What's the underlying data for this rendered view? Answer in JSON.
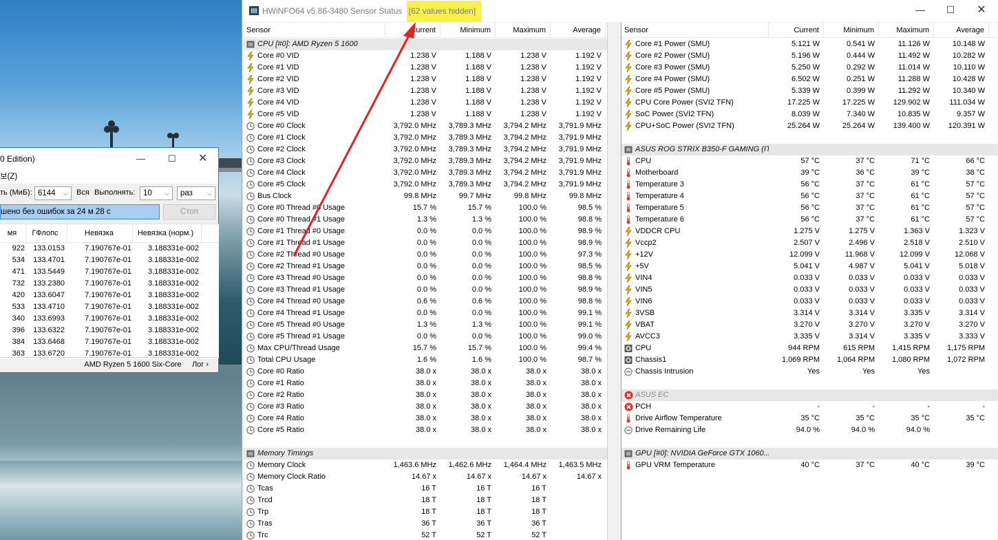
{
  "hwinfo": {
    "title": "HWiNFO64 v5.86-3480 Sensor Status",
    "title_highlight": "[62 values hidden]",
    "columns": [
      "Sensor",
      "Current",
      "Minimum",
      "Maximum",
      "Average"
    ],
    "left": [
      {
        "g": "CPU [#0]: AMD Ryzen 5 1600"
      },
      {
        "i": "bolt",
        "n": "Core #0 VID",
        "v": [
          "1.238 V",
          "1.188 V",
          "1.238 V",
          "1.192 V"
        ]
      },
      {
        "i": "bolt",
        "n": "Core #1 VID",
        "v": [
          "1.238 V",
          "1.188 V",
          "1.238 V",
          "1.192 V"
        ]
      },
      {
        "i": "bolt",
        "n": "Core #2 VID",
        "v": [
          "1.238 V",
          "1.188 V",
          "1.238 V",
          "1.192 V"
        ]
      },
      {
        "i": "bolt",
        "n": "Core #3 VID",
        "v": [
          "1.238 V",
          "1.188 V",
          "1.238 V",
          "1.192 V"
        ]
      },
      {
        "i": "bolt",
        "n": "Core #4 VID",
        "v": [
          "1.238 V",
          "1.188 V",
          "1.238 V",
          "1.192 V"
        ]
      },
      {
        "i": "bolt",
        "n": "Core #5 VID",
        "v": [
          "1.238 V",
          "1.188 V",
          "1.238 V",
          "1.192 V"
        ]
      },
      {
        "i": "clock",
        "n": "Core #0 Clock",
        "v": [
          "3,792.0 MHz",
          "3,789.3 MHz",
          "3,794.2 MHz",
          "3,791.9 MHz"
        ]
      },
      {
        "i": "clock",
        "n": "Core #1 Clock",
        "v": [
          "3,792.0 MHz",
          "3,789.3 MHz",
          "3,794.2 MHz",
          "3,791.9 MHz"
        ]
      },
      {
        "i": "clock",
        "n": "Core #2 Clock",
        "v": [
          "3,792.0 MHz",
          "3,789.3 MHz",
          "3,794.2 MHz",
          "3,791.9 MHz"
        ]
      },
      {
        "i": "clock",
        "n": "Core #3 Clock",
        "v": [
          "3,792.0 MHz",
          "3,789.3 MHz",
          "3,794.2 MHz",
          "3,791.9 MHz"
        ]
      },
      {
        "i": "clock",
        "n": "Core #4 Clock",
        "v": [
          "3,792.0 MHz",
          "3,789.3 MHz",
          "3,794.2 MHz",
          "3,791.9 MHz"
        ]
      },
      {
        "i": "clock",
        "n": "Core #5 Clock",
        "v": [
          "3,792.0 MHz",
          "3,789.3 MHz",
          "3,794.2 MHz",
          "3,791.9 MHz"
        ]
      },
      {
        "i": "clock",
        "n": "Bus Clock",
        "v": [
          "99.8 MHz",
          "99.7 MHz",
          "99.8 MHz",
          "99.8 MHz"
        ]
      },
      {
        "i": "clock",
        "n": "Core #0 Thread #0 Usage",
        "v": [
          "15.7 %",
          "15.7 %",
          "100.0 %",
          "98.5 %"
        ]
      },
      {
        "i": "clock",
        "n": "Core #0 Thread #1 Usage",
        "v": [
          "1.3 %",
          "1.3 %",
          "100.0 %",
          "98.8 %"
        ]
      },
      {
        "i": "clock",
        "n": "Core #1 Thread #0 Usage",
        "v": [
          "0.0 %",
          "0.0 %",
          "100.0 %",
          "98.9 %"
        ]
      },
      {
        "i": "clock",
        "n": "Core #1 Thread #1 Usage",
        "v": [
          "0.0 %",
          "0.0 %",
          "100.0 %",
          "98.9 %"
        ]
      },
      {
        "i": "clock",
        "n": "Core #2 Thread #0 Usage",
        "v": [
          "0.0 %",
          "0.0 %",
          "100.0 %",
          "97.3 %"
        ]
      },
      {
        "i": "clock",
        "n": "Core #2 Thread #1 Usage",
        "v": [
          "0.0 %",
          "0.0 %",
          "100.0 %",
          "98.5 %"
        ]
      },
      {
        "i": "clock",
        "n": "Core #3 Thread #0 Usage",
        "v": [
          "0.0 %",
          "0.0 %",
          "100.0 %",
          "98.8 %"
        ]
      },
      {
        "i": "clock",
        "n": "Core #3 Thread #1 Usage",
        "v": [
          "0.0 %",
          "0.0 %",
          "100.0 %",
          "98.9 %"
        ]
      },
      {
        "i": "clock",
        "n": "Core #4 Thread #0 Usage",
        "v": [
          "0.6 %",
          "0.6 %",
          "100.0 %",
          "98.8 %"
        ]
      },
      {
        "i": "clock",
        "n": "Core #4 Thread #1 Usage",
        "v": [
          "0.0 %",
          "0.0 %",
          "100.0 %",
          "99.1 %"
        ]
      },
      {
        "i": "clock",
        "n": "Core #5 Thread #0 Usage",
        "v": [
          "1.3 %",
          "1.3 %",
          "100.0 %",
          "99.1 %"
        ]
      },
      {
        "i": "clock",
        "n": "Core #5 Thread #1 Usage",
        "v": [
          "0.0 %",
          "0.0 %",
          "100.0 %",
          "99.0 %"
        ]
      },
      {
        "i": "clock",
        "n": "Max CPU/Thread Usage",
        "v": [
          "15.7 %",
          "15.7 %",
          "100.0 %",
          "99.4 %"
        ]
      },
      {
        "i": "clock",
        "n": "Total CPU Usage",
        "v": [
          "1.6 %",
          "1.6 %",
          "100.0 %",
          "98.7 %"
        ]
      },
      {
        "i": "clock",
        "n": "Core #0 Ratio",
        "v": [
          "38.0 x",
          "38.0 x",
          "38.0 x",
          "38.0 x"
        ]
      },
      {
        "i": "clock",
        "n": "Core #1 Ratio",
        "v": [
          "38.0 x",
          "38.0 x",
          "38.0 x",
          "38.0 x"
        ]
      },
      {
        "i": "clock",
        "n": "Core #2 Ratio",
        "v": [
          "38.0 x",
          "38.0 x",
          "38.0 x",
          "38.0 x"
        ]
      },
      {
        "i": "clock",
        "n": "Core #3 Ratio",
        "v": [
          "38.0 x",
          "38.0 x",
          "38.0 x",
          "38.0 x"
        ]
      },
      {
        "i": "clock",
        "n": "Core #4 Ratio",
        "v": [
          "38.0 x",
          "38.0 x",
          "38.0 x",
          "38.0 x"
        ]
      },
      {
        "i": "clock",
        "n": "Core #5 Ratio",
        "v": [
          "38.0 x",
          "38.0 x",
          "38.0 x",
          "38.0 x"
        ]
      },
      {
        "blank": true
      },
      {
        "g": "Memory Timings"
      },
      {
        "i": "clock",
        "n": "Memory Clock",
        "v": [
          "1,463.6 MHz",
          "1,462.6 MHz",
          "1,464.4 MHz",
          "1,463.5 MHz"
        ]
      },
      {
        "i": "clock",
        "n": "Memory Clock Ratio",
        "v": [
          "14.67 x",
          "14.67 x",
          "14.67 x",
          "14.67 x"
        ]
      },
      {
        "i": "clock",
        "n": "Tcas",
        "v": [
          "16 T",
          "16 T",
          "16 T",
          ""
        ]
      },
      {
        "i": "clock",
        "n": "Trcd",
        "v": [
          "18 T",
          "18 T",
          "18 T",
          ""
        ]
      },
      {
        "i": "clock",
        "n": "Trp",
        "v": [
          "18 T",
          "18 T",
          "18 T",
          ""
        ]
      },
      {
        "i": "clock",
        "n": "Tras",
        "v": [
          "36 T",
          "36 T",
          "36 T",
          ""
        ]
      },
      {
        "i": "clock",
        "n": "Trc",
        "v": [
          "52 T",
          "52 T",
          "52 T",
          ""
        ]
      }
    ],
    "right": [
      {
        "i": "bolt",
        "n": "Core #1 Power (SMU)",
        "v": [
          "5.121 W",
          "0.541 W",
          "11.126 W",
          "10.148 W"
        ]
      },
      {
        "i": "bolt",
        "n": "Core #2 Power (SMU)",
        "v": [
          "5.196 W",
          "0.444 W",
          "11.492 W",
          "10.282 W"
        ]
      },
      {
        "i": "bolt",
        "n": "Core #3 Power (SMU)",
        "v": [
          "5.250 W",
          "0.292 W",
          "11.014 W",
          "10.110 W"
        ]
      },
      {
        "i": "bolt",
        "n": "Core #4 Power (SMU)",
        "v": [
          "6.502 W",
          "0.251 W",
          "11.288 W",
          "10.428 W"
        ]
      },
      {
        "i": "bolt",
        "n": "Core #5 Power (SMU)",
        "v": [
          "5.339 W",
          "0.399 W",
          "11.292 W",
          "10.340 W"
        ]
      },
      {
        "i": "bolt",
        "n": "CPU Core Power (SVI2 TFN)",
        "v": [
          "17.225 W",
          "17.225 W",
          "129.902 W",
          "111.034 W"
        ]
      },
      {
        "i": "bolt",
        "n": "SoC Power (SVI2 TFN)",
        "v": [
          "8.039 W",
          "7.340 W",
          "10.835 W",
          "9.357 W"
        ]
      },
      {
        "i": "bolt",
        "n": "CPU+SoC Power (SVI2 TFN)",
        "v": [
          "25.264 W",
          "25.264 W",
          "139.400 W",
          "120.391 W"
        ]
      },
      {
        "blank": true
      },
      {
        "g": "ASUS ROG STRIX B350-F GAMING (IT..."
      },
      {
        "i": "therm",
        "n": "CPU",
        "v": [
          "57 °C",
          "37 °C",
          "71 °C",
          "66 °C"
        ]
      },
      {
        "i": "therm",
        "n": "Motherboard",
        "v": [
          "39 °C",
          "36 °C",
          "39 °C",
          "38 °C"
        ]
      },
      {
        "i": "therm",
        "n": "Temperature 3",
        "v": [
          "56 °C",
          "37 °C",
          "61 °C",
          "57 °C"
        ]
      },
      {
        "i": "therm",
        "n": "Temperature 4",
        "v": [
          "56 °C",
          "37 °C",
          "61 °C",
          "57 °C"
        ]
      },
      {
        "i": "therm",
        "n": "Temperature 5",
        "v": [
          "56 °C",
          "37 °C",
          "61 °C",
          "57 °C"
        ]
      },
      {
        "i": "therm",
        "n": "Temperature 6",
        "v": [
          "56 °C",
          "37 °C",
          "61 °C",
          "57 °C"
        ]
      },
      {
        "i": "bolt",
        "n": "VDDCR CPU",
        "v": [
          "1.275 V",
          "1.275 V",
          "1.363 V",
          "1.323 V"
        ]
      },
      {
        "i": "bolt",
        "n": "Vccp2",
        "v": [
          "2.507 V",
          "2.496 V",
          "2.518 V",
          "2.510 V"
        ]
      },
      {
        "i": "bolt",
        "n": "+12V",
        "v": [
          "12.099 V",
          "11.968 V",
          "12.099 V",
          "12.068 V"
        ]
      },
      {
        "i": "bolt",
        "n": "+5V",
        "v": [
          "5.041 V",
          "4.987 V",
          "5.041 V",
          "5.018 V"
        ]
      },
      {
        "i": "bolt",
        "n": "VIN4",
        "v": [
          "0.033 V",
          "0.033 V",
          "0.033 V",
          "0.033 V"
        ]
      },
      {
        "i": "bolt",
        "n": "VIN5",
        "v": [
          "0.033 V",
          "0.033 V",
          "0.033 V",
          "0.033 V"
        ]
      },
      {
        "i": "bolt",
        "n": "VIN6",
        "v": [
          "0.033 V",
          "0.033 V",
          "0.033 V",
          "0.033 V"
        ]
      },
      {
        "i": "bolt",
        "n": "3VSB",
        "v": [
          "3.314 V",
          "3.314 V",
          "3.335 V",
          "3.314 V"
        ]
      },
      {
        "i": "bolt",
        "n": "VBAT",
        "v": [
          "3.270 V",
          "3.270 V",
          "3.270 V",
          "3.270 V"
        ]
      },
      {
        "i": "bolt",
        "n": "AVCC3",
        "v": [
          "3.335 V",
          "3.314 V",
          "3.335 V",
          "3.333 V"
        ]
      },
      {
        "i": "fan",
        "n": "CPU",
        "v": [
          "944 RPM",
          "615 RPM",
          "1,415 RPM",
          "1,175 RPM"
        ]
      },
      {
        "i": "fan",
        "n": "Chassis1",
        "v": [
          "1,069 RPM",
          "1,064 RPM",
          "1,080 RPM",
          "1,072 RPM"
        ]
      },
      {
        "i": "circle",
        "n": "Chassis Intrusion",
        "v": [
          "Yes",
          "Yes",
          "Yes",
          ""
        ]
      },
      {
        "blank": true
      },
      {
        "g": "ASUS EC",
        "dim": true,
        "gi": "error"
      },
      {
        "i": "error",
        "n": "PCH",
        "v": [
          "-",
          "-",
          "-",
          "-"
        ]
      },
      {
        "i": "therm",
        "n": "Drive Airflow Temperature",
        "v": [
          "35 °C",
          "35 °C",
          "35 °C",
          "35 °C"
        ]
      },
      {
        "i": "circle",
        "n": "Drive Remaining Life",
        "v": [
          "94.0 %",
          "94.0 %",
          "94.0 %",
          ""
        ]
      },
      {
        "blank": true
      },
      {
        "g": "GPU [#0]: NVIDIA GeForce GTX 1060..."
      },
      {
        "i": "therm",
        "n": "GPU VRM Temperature",
        "v": [
          "40 °C",
          "37 °C",
          "40 °C",
          "39 °C"
        ]
      }
    ]
  },
  "linx": {
    "title_fragment": "0 Edition)",
    "menu_fragment": "보(Z)",
    "mem_label": "ть (МиБ):",
    "mem_value": "6144",
    "all_label": "Вся",
    "run_label": "Выполнять:",
    "run_value": "10",
    "unit_value": "раз",
    "progress_text": "шено без ошибок за 24 м 28 с",
    "stop_label": "Стоп",
    "columns": [
      "мя",
      "ГФлопс",
      "Невязка",
      "Невязка (норм.)"
    ],
    "rows": [
      [
        "922",
        "133.0153",
        "7.190767e-01",
        "3.188331e-002"
      ],
      [
        "534",
        "133.4701",
        "7.190767e-01",
        "3.188331e-002"
      ],
      [
        "471",
        "133.5449",
        "7.190767e-01",
        "3.188331e-002"
      ],
      [
        "732",
        "133.2380",
        "7.190767e-01",
        "3.188331e-002"
      ],
      [
        "420",
        "133.6047",
        "7.190767e-01",
        "3.188331e-002"
      ],
      [
        "533",
        "133.4710",
        "7.190767e-01",
        "3.188331e-002"
      ],
      [
        "340",
        "133.6993",
        "7.190767e-01",
        "3.188331e-002"
      ],
      [
        "396",
        "133.6322",
        "7.190767e-01",
        "3.188331e-002"
      ],
      [
        "384",
        "133.6468",
        "7.190767e-01",
        "3.188331e-002"
      ],
      [
        "363",
        "133.6720",
        "7.190767e-01",
        "3.188331e-002"
      ]
    ],
    "status_cpu": "AMD Ryzen 5 1600 Six-Core",
    "status_log": "Лог ›"
  },
  "colors": {
    "highlight": "#f8f14a",
    "arrow": "#e8201c",
    "accent": "#1883d7",
    "progress": "#a7cdf0"
  }
}
